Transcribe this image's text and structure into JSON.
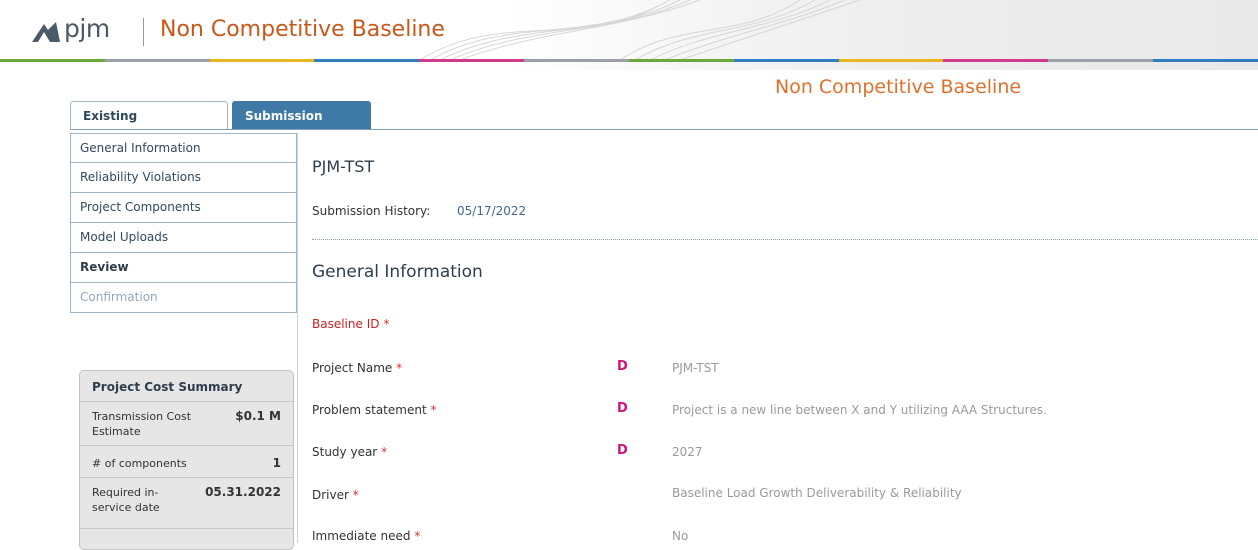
{
  "header": {
    "logo_text": "pjm",
    "title": "Non Competitive Baseline",
    "colors": [
      "#6aaa3a",
      "#9aa0a6",
      "#e9b520",
      "#2f7fc0",
      "#d03a8c",
      "#9aa0a6",
      "#6aaa3a",
      "#2f7fc0",
      "#e9b520",
      "#d03a8c",
      "#9aa0a6",
      "#2f7fc0"
    ]
  },
  "page_heading": "Non Competitive Baseline",
  "tabs": [
    {
      "label": "Existing Submissions",
      "active": false
    },
    {
      "label": "Submission Form",
      "active": true
    }
  ],
  "nav": [
    {
      "label": "General Information"
    },
    {
      "label": "Reliability Violations"
    },
    {
      "label": "Project Components"
    },
    {
      "label": "Model Uploads"
    },
    {
      "label": "Review"
    },
    {
      "label": "Confirmation"
    }
  ],
  "cost_summary": {
    "title": "Project Cost Summary",
    "rows": [
      {
        "label": "Transmission Cost Estimate",
        "value": "$0.1 M"
      },
      {
        "label": "# of components",
        "value": "1"
      },
      {
        "label": "Required in-service date",
        "value": "05.31.2022"
      }
    ]
  },
  "main": {
    "title": "PJM-TST",
    "history_label": "Submission History:",
    "history_date": "05/17/2022",
    "section_title": "General Information",
    "required_mark": "*",
    "fields": [
      {
        "label": "Baseline ID",
        "marker": "",
        "value": ""
      },
      {
        "label": "Project Name",
        "marker": "D",
        "value": "PJM-TST"
      },
      {
        "label": "Problem statement",
        "marker": "D",
        "value": "Project is a new line between X and Y utilizing AAA Structures."
      },
      {
        "label": "Study year",
        "marker": "D",
        "value": "2027"
      },
      {
        "label": "Driver",
        "marker": "",
        "value": "Baseline Load Growth Deliverability & Reliability"
      },
      {
        "label": "Immediate need",
        "marker": "",
        "value": "No"
      }
    ]
  }
}
